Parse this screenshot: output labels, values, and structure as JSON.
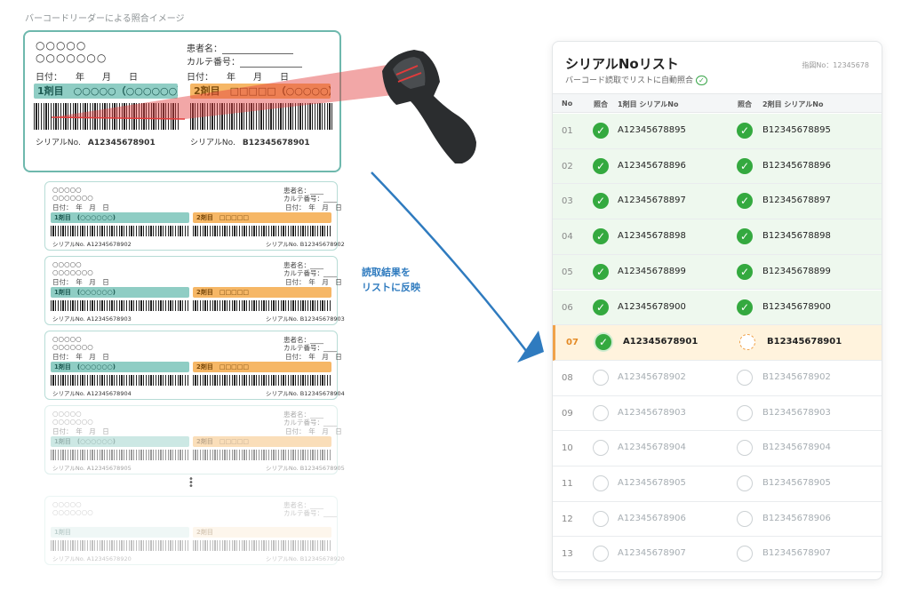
{
  "caption": "バーコードリーダーによる照合イメージ",
  "main_label": {
    "circles_row1": "○○○○○",
    "circles_row2": "○○○○○○○",
    "patient_label": "患者名：",
    "chart_label": "カルテ番号：",
    "date_left": "日付：　　年　　月　　日",
    "date_right": "日付：　　年　　月　　日",
    "band1": "1剤目　○○○○○（○○○○○○）",
    "band2": "2剤目　□□□□□（○○○○○）",
    "serial_label": "シリアルNo.",
    "serial1": "A12345678901",
    "serial2": "B12345678901"
  },
  "small_labels": [
    {
      "circles1": "○○○○○",
      "circles2": "○○○○○○○",
      "patient": "患者名：____",
      "chart": "カルテ番号：____",
      "date1": "日付：　年　月　日",
      "date2": "日付：　年　月　日",
      "band1": "1剤目　(○○○○○○)",
      "band2": "2剤目　□□□□□",
      "serial_a": "シリアルNo. A12345678902",
      "serial_b": "シリアルNo. B12345678902"
    },
    {
      "circles1": "○○○○○",
      "circles2": "○○○○○○○",
      "patient": "患者名：____",
      "chart": "カルテ番号：____",
      "date1": "日付：　年　月　日",
      "date2": "日付：　年　月　日",
      "band1": "1剤目　(○○○○○○)",
      "band2": "2剤目　□□□□□",
      "serial_a": "シリアルNo. A12345678903",
      "serial_b": "シリアルNo. B12345678903"
    },
    {
      "circles1": "○○○○○",
      "circles2": "○○○○○○○",
      "patient": "患者名：____",
      "chart": "カルテ番号：____",
      "date1": "日付：　年　月　日",
      "date2": "日付：　年　月　日",
      "band1": "1剤目　(○○○○○○)",
      "band2": "2剤目　□□□□□",
      "serial_a": "シリアルNo. A12345678904",
      "serial_b": "シリアルNo. B12345678904"
    },
    {
      "circles1": "○○○○○",
      "circles2": "○○○○○○○",
      "patient": "患者名：____",
      "chart": "カルテ番号：____",
      "date1": "日付：　年　月　日",
      "date2": "日付：　年　月　日",
      "band1": "1剤目　(○○○○○○)",
      "band2": "2剤目　□□□□□",
      "serial_a": "シリアルNo. A12345678905",
      "serial_b": "シリアルNo. B12345678905"
    },
    {
      "circles1": "○○○○○",
      "circles2": "○○○○○○○",
      "patient": "患者名：____",
      "chart": "カルテ番号：____",
      "date1": "",
      "date2": "",
      "band1": "1剤目",
      "band2": "2剤目",
      "serial_a": "シリアルNo. A12345678920",
      "serial_b": "シリアルNo. B12345678920"
    }
  ],
  "arrow_text": [
    "読取結果を",
    "リストに反映"
  ],
  "panel": {
    "title": "シリアルNoリスト",
    "subtitle": "バーコード読取でリストに自動照合",
    "check_glyph": "✓",
    "doc_no": "指図No：12345678",
    "headers": {
      "no": "No",
      "match1": "照合",
      "serial1": "1剤目 シリアルNo",
      "match2": "照合",
      "serial2": "2剤目 シリアルNo"
    },
    "rows": [
      {
        "no": "01",
        "s1": "A12345678895",
        "s2": "B12345678895",
        "state": "done"
      },
      {
        "no": "02",
        "s1": "A12345678896",
        "s2": "B12345678896",
        "state": "done"
      },
      {
        "no": "03",
        "s1": "A12345678897",
        "s2": "B12345678897",
        "state": "done"
      },
      {
        "no": "04",
        "s1": "A12345678898",
        "s2": "B12345678898",
        "state": "done"
      },
      {
        "no": "05",
        "s1": "A12345678899",
        "s2": "B12345678899",
        "state": "done"
      },
      {
        "no": "06",
        "s1": "A12345678900",
        "s2": "B12345678900",
        "state": "done"
      },
      {
        "no": "07",
        "s1": "A12345678901",
        "s2": "B12345678901",
        "state": "current"
      },
      {
        "no": "08",
        "s1": "A12345678902",
        "s2": "B12345678902",
        "state": "todo"
      },
      {
        "no": "09",
        "s1": "A12345678903",
        "s2": "B12345678903",
        "state": "todo"
      },
      {
        "no": "10",
        "s1": "A12345678904",
        "s2": "B12345678904",
        "state": "todo"
      },
      {
        "no": "11",
        "s1": "A12345678905",
        "s2": "B12345678905",
        "state": "todo"
      },
      {
        "no": "12",
        "s1": "A12345678906",
        "s2": "B12345678906",
        "state": "todo"
      },
      {
        "no": "13",
        "s1": "A12345678907",
        "s2": "B12345678907",
        "state": "todo"
      }
    ]
  },
  "colors": {
    "teal": "#8fcdc4",
    "orange": "#f6b766",
    "green": "#34a93f",
    "blue_arrow": "#2f7bbf",
    "laser": "#e23b3b"
  },
  "icons": {
    "scanner": "barcode-scanner-icon",
    "check": "check-circle-icon",
    "arrow": "curved-arrow"
  }
}
